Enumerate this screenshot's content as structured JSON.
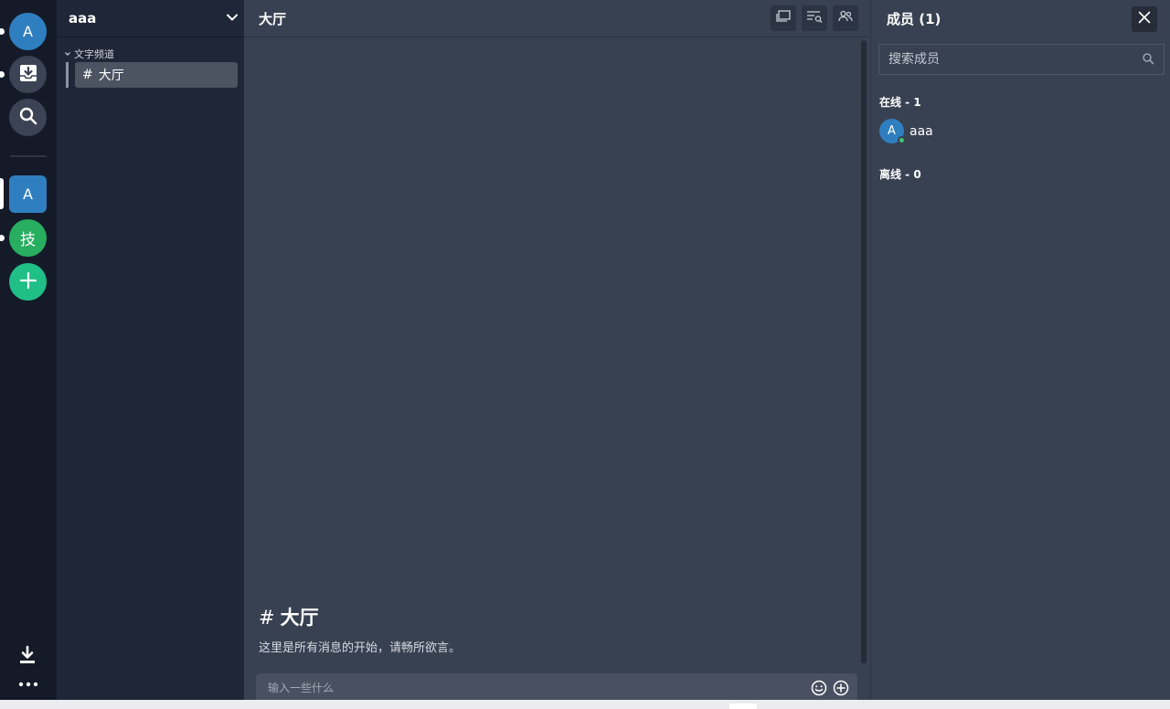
{
  "rail": {
    "home_avatar_letter": "A",
    "server_a_letter": "A",
    "server_tech_letter": "技",
    "colors": {
      "home": "#2f7fc0",
      "server_a": "#2f7fc0",
      "server_tech": "#27ae60",
      "add": "#1fbf87"
    }
  },
  "sidebar": {
    "server_name": "aaa",
    "category_label": "文字频道",
    "channels": [
      {
        "label": "大厅",
        "active": true
      }
    ]
  },
  "main": {
    "title": "大厅",
    "welcome_title": "大厅",
    "welcome_subtitle": "这里是所有消息的开始，请畅所欲言。",
    "composer_placeholder": "输入一些什么"
  },
  "members": {
    "title": "成员 (1)",
    "search_placeholder": "搜索成员",
    "online_label": "在线 - 1",
    "offline_label": "离线 - 0",
    "online_list": [
      {
        "avatar_letter": "A",
        "name": "aaa",
        "status": "online"
      }
    ]
  },
  "icons": {
    "rail": [
      "inbox-icon",
      "search-icon",
      "plus-icon",
      "download-icon",
      "more-icon"
    ],
    "header": [
      "window-icon",
      "search-list-icon",
      "members-icon"
    ],
    "composer": [
      "emoji-icon",
      "add-circle-icon"
    ]
  }
}
